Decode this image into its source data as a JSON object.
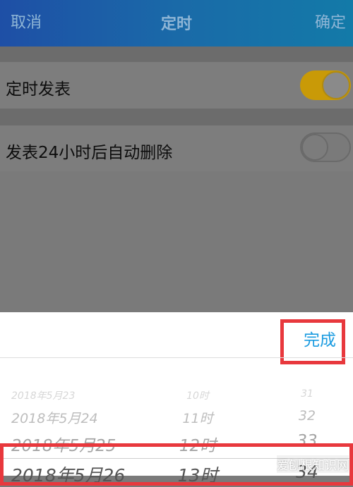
{
  "header": {
    "cancel_label": "取消",
    "title": "定时",
    "confirm_label": "确定"
  },
  "settings": {
    "scheduled_post": {
      "label": "定时发表",
      "enabled": true
    },
    "auto_delete": {
      "label": "发表24小时后自动删除",
      "enabled": false
    }
  },
  "picker": {
    "done_label": "完成",
    "rows": [
      {
        "date": "2018年5月23",
        "hour": "10时",
        "minute": "31"
      },
      {
        "date": "2018年5月24",
        "hour": "11时",
        "minute": "32"
      },
      {
        "date": "2018年5月25",
        "hour": "12时",
        "minute": "33"
      },
      {
        "date": "2018年5月26",
        "hour": "13时",
        "minute": "34"
      }
    ]
  },
  "watermark": "爱刨根知识网",
  "colors": {
    "accent": "#1a9be0",
    "toggle_on": "#c99a07",
    "highlight": "#e8383d"
  }
}
